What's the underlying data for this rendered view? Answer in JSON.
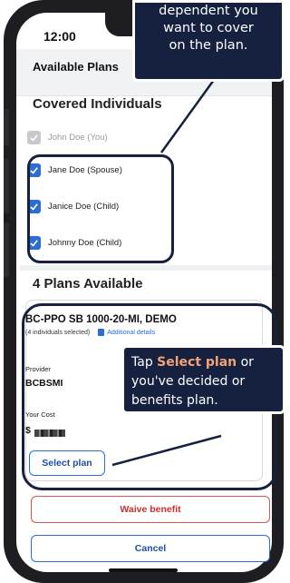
{
  "status": {
    "time": "12:00"
  },
  "header": {
    "title": "Available Plans"
  },
  "covered": {
    "title": "Covered Individuals",
    "members": [
      {
        "label": "John Doe (You)",
        "checked": true,
        "disabled": true
      },
      {
        "label": "Jane Doe (Spouse)",
        "checked": true,
        "disabled": false
      },
      {
        "label": "Janice Doe (Child)",
        "checked": true,
        "disabled": false
      },
      {
        "label": "Johnny Doe (Child)",
        "checked": true,
        "disabled": false
      }
    ]
  },
  "plans": {
    "count_title": "4 Plans Available",
    "card": {
      "name": "BC-PPO SB 1000-20-MI, DEMO",
      "individuals": "(4 individuals selected)",
      "details_link": "Additional details",
      "provider_label": "Provider",
      "provider_value": "BCBSMI",
      "cost_label": "Your Cost",
      "cost_prefix": "$",
      "select_label": "Select plan"
    }
  },
  "actions": {
    "waive_label": "Waive benefit",
    "cancel_label": "Cancel"
  },
  "callouts": {
    "top_lines": [
      "dependent you",
      "want to cover",
      "on the plan."
    ],
    "mid_line1_pre": "Tap ",
    "mid_line1_hl": "Select plan",
    "mid_line1_post": " or",
    "mid_line2": "you've decided or",
    "mid_line3": "benefits plan."
  },
  "colors": {
    "accent": "#2a6ed4",
    "callout_bg": "#16213f",
    "danger": "#d9534f",
    "highlight": "#f4a27a"
  }
}
